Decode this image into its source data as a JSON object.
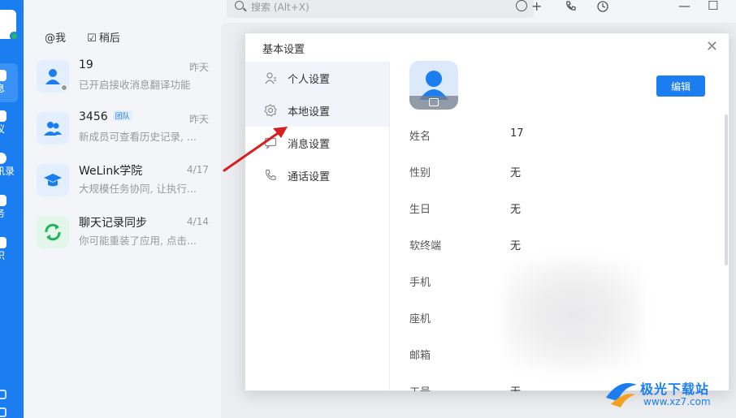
{
  "search": {
    "placeholder": "搜索 (Alt+X)"
  },
  "rail": {
    "items": [
      {
        "label": "息"
      },
      {
        "label": "议"
      },
      {
        "label": "讯录"
      },
      {
        "label": "务"
      },
      {
        "label": "识"
      }
    ]
  },
  "filters": [
    {
      "icon": "at-icon",
      "label": "@我"
    },
    {
      "icon": "check-square-icon",
      "label": "稍后"
    }
  ],
  "chats": [
    {
      "name": "19",
      "tag": "",
      "time": "昨天",
      "preview": "已开启接收消息翻译功能"
    },
    {
      "name": "3456",
      "tag": "团队",
      "time": "昨天",
      "preview": "新成员可查看历史记录, ..."
    },
    {
      "name": "WeLink学院",
      "tag": "",
      "time": "4/17",
      "preview": "大规模任务协同, 让执行..."
    },
    {
      "name": "聊天记录同步",
      "tag": "",
      "time": "4/14",
      "preview": "你可能重装了应用, 点击..."
    }
  ],
  "dialog": {
    "title": "基本设置",
    "menu": [
      {
        "label": "个人设置",
        "icon": "person-icon"
      },
      {
        "label": "本地设置",
        "icon": "gear-icon"
      },
      {
        "label": "消息设置",
        "icon": "message-icon"
      },
      {
        "label": "通话设置",
        "icon": "phone-icon"
      }
    ],
    "edit_label": "编辑",
    "fields": [
      {
        "key": "姓名",
        "value": "17"
      },
      {
        "key": "性别",
        "value": "无"
      },
      {
        "key": "生日",
        "value": "无"
      },
      {
        "key": "软终端",
        "value": "无"
      },
      {
        "key": "手机",
        "value": ""
      },
      {
        "key": "座机",
        "value": ""
      },
      {
        "key": "邮箱",
        "value": ""
      },
      {
        "key": "工号",
        "value": "无"
      }
    ]
  },
  "watermark": {
    "line1": "极光下载站",
    "line2": "www.xz7.com"
  },
  "colors": {
    "accent": "#1b7ef0",
    "arrow": "#d42020"
  }
}
